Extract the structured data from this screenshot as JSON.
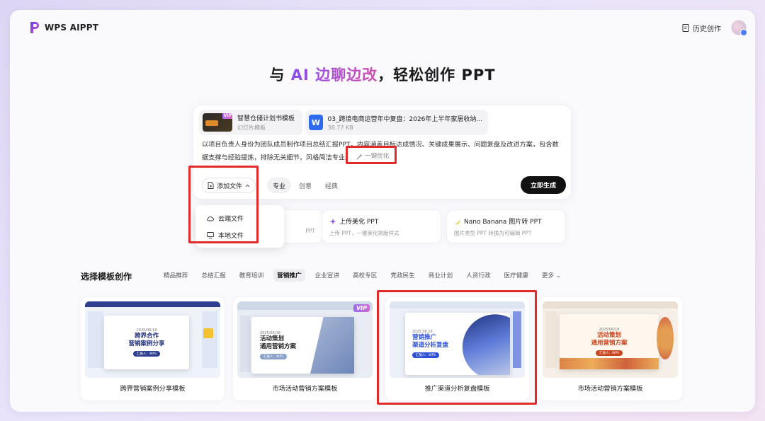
{
  "app": {
    "name": "WPS AIPPT",
    "history_label": "历史创作"
  },
  "headline": {
    "prefix": "与 ",
    "highlight": "AI 边聊边改",
    "suffix": "，轻松创作 PPT"
  },
  "attachments": [
    {
      "title": "智慧仓储计划书模板",
      "subtitle": "幻灯片模板",
      "badge": "VIP"
    },
    {
      "title": "03_跨境电商运营年中复盘：2026年上半年家居收纳...",
      "subtitle": "38.77 KB",
      "icon_letter": "W"
    }
  ],
  "prompt_text": "以项目负责人身份为团队成员制作项目总结汇报PPT，内容涵盖目标达成情况、关键成果展示、问题复盘及改进方案，包含数据支撑与经验提炼，排除无关细节，风格简洁专业。",
  "optimize_label": "一键优化",
  "add_file_label": "添加文件",
  "style_tabs": [
    "专业",
    "创意",
    "经典"
  ],
  "generate_label": "立即生成",
  "dropdown": {
    "items": [
      "云端文件",
      "本地文件"
    ]
  },
  "features": [
    {
      "title": "",
      "desc": "PPT"
    },
    {
      "title": "上传美化 PPT",
      "desc": "上传 PPT，一键美化排版样式"
    },
    {
      "title": "Nano Banana 图片转 PPT",
      "desc": "图片类型 PPT 转换为可编辑 PPT"
    }
  ],
  "templates_section": {
    "title": "选择模板创作",
    "categories": [
      "精品推荐",
      "总结汇报",
      "教育培训",
      "营销推广",
      "企业宣讲",
      "高校专区",
      "党政民生",
      "商业计划",
      "人资行政",
      "医疗健康",
      "更多"
    ],
    "active_category": "营销推广"
  },
  "templates": [
    {
      "label": "跨界营销案例分享模板",
      "slide_date": "2025/06/18",
      "slide_title_1": "跨界合作",
      "slide_title_2": "营销案例分享",
      "slide_pill": "汇报人：WPS"
    },
    {
      "label": "市场活动营销方案模板",
      "slide_date": "2025/06/18",
      "slide_title_1": "活动策划",
      "slide_title_2": "通用营销方案",
      "slide_pill": "汇报人：WPS",
      "badge": "VIP"
    },
    {
      "label": "推广渠道分析复盘模板",
      "slide_date": "2025.06.18",
      "slide_title_1": "营销推广",
      "slide_title_2": "渠道分析复盘",
      "slide_pill": "汇报人：WPS"
    },
    {
      "label": "市场活动营销方案模板",
      "slide_date": "2025/06/18",
      "slide_title_1": "活动策划",
      "slide_title_2": "通用营销方案",
      "slide_pill": "汇报人：WPS"
    }
  ],
  "colors": {
    "accent_purple": "#8a4cf0",
    "accent_pink": "#d04fb0",
    "highlight_red": "#e12a2a",
    "brand_blue": "#2f6bef",
    "generate_bg": "#111111"
  }
}
